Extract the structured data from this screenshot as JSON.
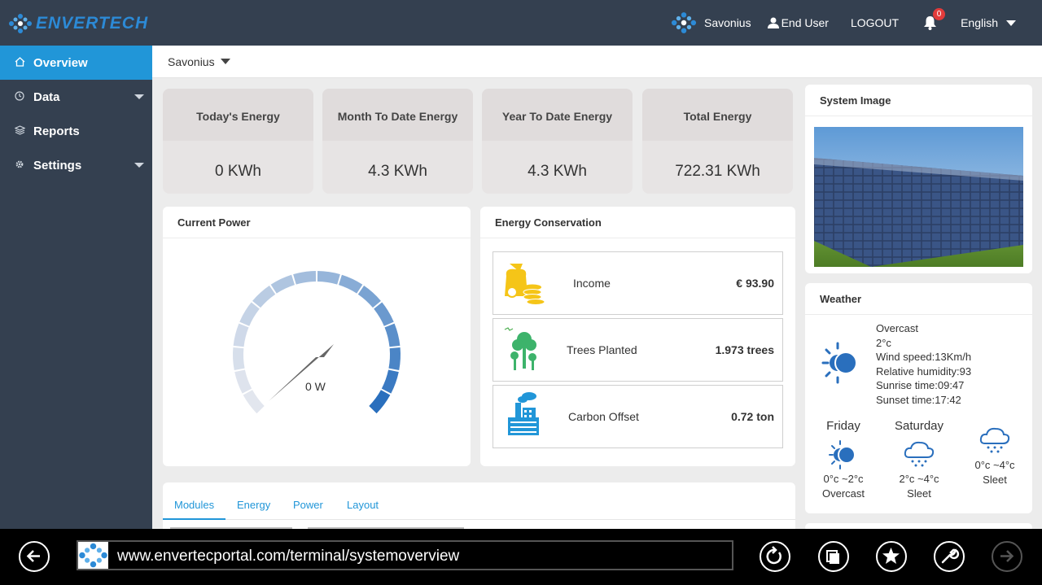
{
  "app": {
    "logo_text": "ENVERTECH"
  },
  "header": {
    "plant_name": "Savonius",
    "user_label": "End User",
    "logout_label": "LOGOUT",
    "notifications_count": "0",
    "language": "English"
  },
  "sidebar": {
    "items": [
      {
        "label": "Overview",
        "icon": "home-icon",
        "active": true
      },
      {
        "label": "Data",
        "icon": "clock-icon"
      },
      {
        "label": "Reports",
        "icon": "stack-icon"
      },
      {
        "label": "Settings",
        "icon": "gear-icon"
      }
    ]
  },
  "breadcrumb": {
    "plant": "Savonius"
  },
  "stats": [
    {
      "title": "Today's Energy",
      "value": "0 KWh"
    },
    {
      "title": "Month To Date Energy",
      "value": "4.3 KWh"
    },
    {
      "title": "Year To Date Energy",
      "value": "4.3 KWh"
    },
    {
      "title": "Total Energy",
      "value": "722.31 KWh"
    }
  ],
  "current_power": {
    "title": "Current Power",
    "value": "0 W"
  },
  "energy_conservation": {
    "title": "Energy Conservation",
    "rows": [
      {
        "label": "Income",
        "value": "€ 93.90",
        "icon": "money-bag-icon"
      },
      {
        "label": "Trees Planted",
        "value": "1.973 trees",
        "icon": "trees-icon"
      },
      {
        "label": "Carbon Offset",
        "value": "0.72 ton",
        "icon": "factory-icon"
      }
    ]
  },
  "system_image": {
    "title": "System Image"
  },
  "weather": {
    "title": "Weather",
    "current": {
      "condition": "Overcast",
      "temp": "2°c",
      "wind": "Wind speed:13Km/h",
      "humidity": "Relative humidity:93",
      "sunrise": "Sunrise time:09:47",
      "sunset": "Sunset time:17:42"
    },
    "forecast": [
      {
        "day": "Friday",
        "temp": "0°c ~2°c",
        "condition": "Overcast"
      },
      {
        "day": "Saturday",
        "temp": "2°c ~4°c",
        "condition": "Sleet"
      },
      {
        "day": "",
        "temp": "0°c ~4°c",
        "condition": "Sleet"
      }
    ]
  },
  "tabs": [
    "Modules",
    "Energy",
    "Power",
    "Layout"
  ],
  "browser": {
    "url": "www.envertecportal.com/terminal/systemoverview"
  },
  "colors": {
    "accent": "#2196d8",
    "header": "#344050",
    "gauge_dark": "#2a6fbd",
    "gauge_light": "#e2e6ee"
  }
}
